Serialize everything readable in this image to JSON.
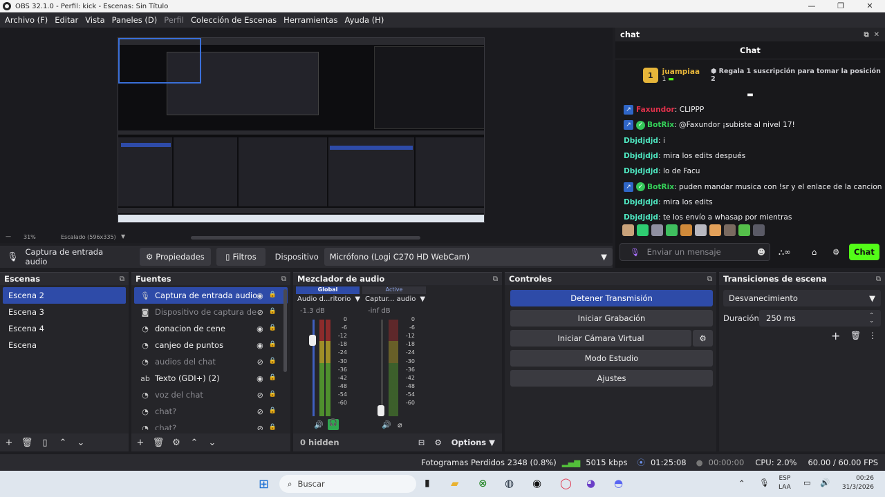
{
  "window": {
    "title": "OBS 32.1.0 - Perfil: kick - Escenas: Sin Título"
  },
  "menu": [
    "Archivo (F)",
    "Editar",
    "Vista",
    "Paneles (D)",
    "Perfil",
    "Colección de Escenas",
    "Herramientas",
    "Ayuda (H)"
  ],
  "preview": {
    "zoom": "31%",
    "scale": "Escalado (596x335)"
  },
  "source_toolbar": {
    "source": "Captura de entrada audio",
    "properties": "Propiedades",
    "filters": "Filtros",
    "device_label": "Dispositivo",
    "device_value": "Micrófono (Logi C270 HD WebCam)"
  },
  "scenes": {
    "title": "Escenas",
    "items": [
      "Escena 2",
      "Escena 3",
      "Escena 4",
      "Escena"
    ],
    "selected": 0
  },
  "sources": {
    "title": "Fuentes",
    "items": [
      {
        "label": "Captura de entrada audio",
        "icon": "mic-icon",
        "visible": true,
        "selected": true
      },
      {
        "label": "Dispositivo de captura de",
        "icon": "camera-icon",
        "visible": false
      },
      {
        "label": "donacion de cene",
        "icon": "browser-icon",
        "visible": true
      },
      {
        "label": "canjeo de puntos",
        "icon": "browser-icon",
        "visible": true
      },
      {
        "label": "audios del chat",
        "icon": "browser-icon",
        "visible": false
      },
      {
        "label": "Texto (GDI+) (2)",
        "icon": "text-icon",
        "visible": true
      },
      {
        "label": "voz del chat",
        "icon": "browser-icon",
        "visible": false
      },
      {
        "label": "chat?",
        "icon": "browser-icon",
        "visible": false
      },
      {
        "label": "chat?",
        "icon": "browser-icon",
        "visible": false
      }
    ]
  },
  "mixer": {
    "title": "Mezclador de audio",
    "tab_global": "Global",
    "tab_active": "Active",
    "channels": [
      {
        "name": "Audio d...ritorio",
        "db": "-1.3 dB",
        "level": 0.82
      },
      {
        "name": "Captur... audio",
        "db": "-inf dB",
        "level": 0
      }
    ],
    "scale": [
      "0",
      "-6",
      "-12",
      "-18",
      "-24",
      "-30",
      "-36",
      "-42",
      "-48",
      "-54",
      "-60"
    ],
    "hidden": "0 hidden",
    "options": "Options"
  },
  "controls": {
    "title": "Controles",
    "buttons": [
      "Detener Transmisión",
      "Iniciar Grabación",
      "Iniciar Cámara Virtual",
      "Modo Estudio",
      "Ajustes"
    ]
  },
  "transitions": {
    "title": "Transiciones de escena",
    "selected": "Desvanecimiento",
    "duration_label": "Duración",
    "duration": "250 ms"
  },
  "chat": {
    "dock_title": "chat",
    "title": "Chat",
    "top_user": "juampiaa",
    "top_rank": "1",
    "top_sub": "1",
    "top_text": "Regala 1 suscripción para tomar la posición 2",
    "messages": [
      {
        "user": "Faxundor",
        "color": "#e0314b",
        "badge": true,
        "verified": false,
        "text": ": CLIPPP"
      },
      {
        "user": "BotRix",
        "color": "#34d058",
        "badge": true,
        "verified": true,
        "text": ": @Faxundor ¡subiste al nivel 17!"
      },
      {
        "user": "Dbjdjdjd",
        "color": "#4ee6c0",
        "badge": false,
        "verified": false,
        "text": ": i"
      },
      {
        "user": "Dbjdjdjd",
        "color": "#4ee6c0",
        "badge": false,
        "verified": false,
        "text": ": mira los edits después"
      },
      {
        "user": "Dbjdjdjd",
        "color": "#4ee6c0",
        "badge": false,
        "verified": false,
        "text": ": lo de Facu"
      },
      {
        "user": "BotRix",
        "color": "#34d058",
        "badge": true,
        "verified": true,
        "text": ": puden mandar musica con !sr y el enlace de la cancion"
      },
      {
        "user": "Dbjdjdjd",
        "color": "#4ee6c0",
        "badge": false,
        "verified": false,
        "text": ": mira los edits"
      },
      {
        "user": "Dbjdjdjd",
        "color": "#4ee6c0",
        "badge": false,
        "verified": false,
        "text": ": te los envío a whasap por mientras"
      }
    ],
    "placeholder": "Enviar un mensaje",
    "send": "Chat"
  },
  "status": {
    "dropped": "Fotogramas Perdidos 2348 (0.8%)",
    "bitrate": "5015 kbps",
    "stream_time": "01:25:08",
    "rec_time": "00:00:00",
    "cpu": "CPU: 2.0%",
    "fps": "60.00 / 60.00 FPS"
  },
  "taskbar": {
    "search": "Buscar",
    "lang": "ESP",
    "lang2": "LAA",
    "time": "00:26",
    "date": "31/3/2026"
  },
  "colors": {
    "accent": "#2e4ba8",
    "kick_green": "#53fc18",
    "panel": "#252529"
  }
}
